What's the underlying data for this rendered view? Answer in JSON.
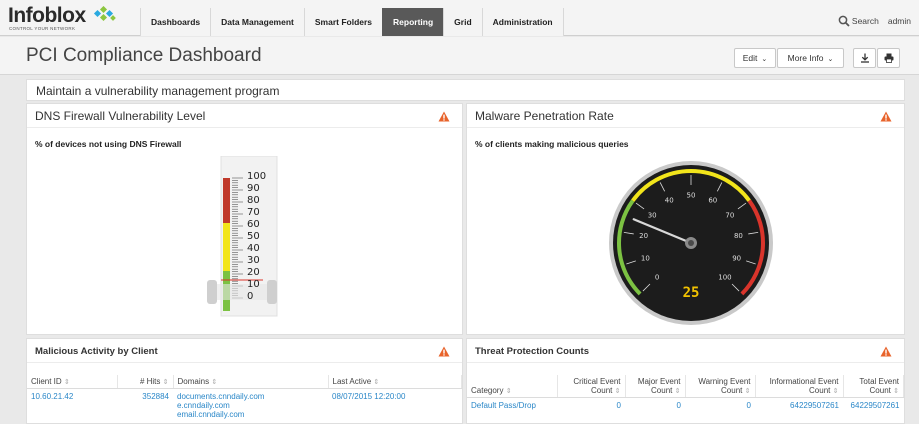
{
  "nav": {
    "logo_text": "Infoblox",
    "logo_tagline": "CONTROL YOUR NETWORK",
    "tabs": [
      "Dashboards",
      "Data Management",
      "Smart Folders",
      "Reporting",
      "Grid",
      "Administration"
    ],
    "active_tab": "Reporting",
    "search_label": "Search",
    "user_label": "admin"
  },
  "header": {
    "title": "PCI Compliance Dashboard",
    "edit_label": "Edit",
    "more_info_label": "More Info"
  },
  "section": {
    "title": "Maintain a vulnerability management program"
  },
  "dns_panel": {
    "title": "DNS Firewall Vulnerability Level",
    "subtitle": "% of devices not using DNS Firewall",
    "scale_labels": [
      "100",
      "90",
      "80",
      "70",
      "60",
      "50",
      "40",
      "30",
      "20",
      "10",
      "0"
    ],
    "value_percent": 15
  },
  "malware_panel": {
    "title": "Malware Penetration Rate",
    "subtitle": "% of clients making malicious queries",
    "scale_labels": [
      "0",
      "10",
      "20",
      "30",
      "40",
      "50",
      "60",
      "70",
      "80",
      "90",
      "100"
    ],
    "value": "25"
  },
  "activity_panel": {
    "title": "Malicious Activity by Client",
    "columns": [
      "Client ID",
      "# Hits",
      "Domains",
      "Last Active"
    ],
    "rows": [
      {
        "client_id": "10.60.21.42",
        "hits": "352884",
        "domains": [
          "documents.cnndaily.com",
          "e.cnndaily.com",
          "email.cnndaily.com"
        ],
        "last_active": "08/07/2015 12:20:00"
      }
    ]
  },
  "threat_panel": {
    "title": "Threat Protection Counts",
    "columns": [
      "Category",
      "Critical Event Count",
      "Major Event Count",
      "Warning Event Count",
      "Informational Event Count",
      "Total Event Count"
    ],
    "rows": [
      {
        "category": "Default Pass/Drop",
        "critical": "0",
        "major": "0",
        "warning": "0",
        "informational": "64229507261",
        "total": "64229507261"
      }
    ]
  },
  "colors": {
    "nav_active": "#595959",
    "link": "#2a87c8",
    "warning": "#e8632b",
    "gauge_green": "#7cc242",
    "gauge_yellow": "#f2e51b",
    "gauge_red": "#d9342b",
    "gauge_value": "#f2c200"
  }
}
